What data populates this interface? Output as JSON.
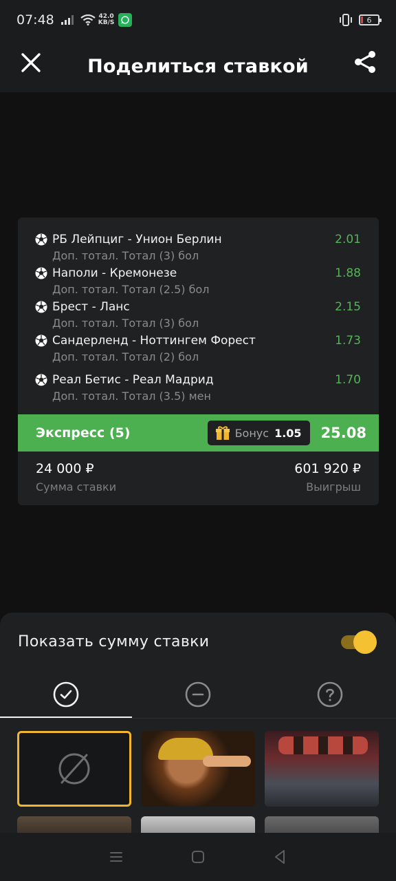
{
  "status": {
    "time": "07:48",
    "speed_value": "42.0",
    "speed_unit": "KB/S",
    "battery": "6"
  },
  "header": {
    "title": "Поделиться ставкой",
    "close_icon": "close-icon",
    "share_icon": "share-icon"
  },
  "bet": {
    "events": [
      {
        "title": "РБ Лейпциг - Унион Берлин",
        "market": "Доп. тотал. Тотал (3) бол",
        "odd": "2.01"
      },
      {
        "title": "Наполи - Кремонезе",
        "market": "Доп. тотал. Тотал (2.5) бол",
        "odd": "1.88"
      },
      {
        "title": "Брест - Ланс",
        "market": "Доп. тотал. Тотал (3) бол",
        "odd": "2.15"
      },
      {
        "title": "Сандерленд - Ноттингем Форест",
        "market": "Доп. тотал. Тотал (2) бол",
        "odd": "1.73"
      },
      {
        "title": "Реал Бетис - Реал Мадрид",
        "market": "Доп. тотал. Тотал (3.5) мен",
        "odd": "1.70"
      }
    ],
    "express_label": "Экспресс (5)",
    "bonus_label": "Бонус",
    "bonus_value": "1.05",
    "total_odd": "25.08",
    "stake_value": "24 000 ₽",
    "stake_caption": "Сумма ставки",
    "win_value": "601 920 ₽",
    "win_caption": "Выигрыш"
  },
  "sheet": {
    "toggle_label": "Показать сумму ставки",
    "toggle_on": true,
    "tabs": [
      {
        "icon": "check-circle-icon",
        "active": true
      },
      {
        "icon": "minus-circle-icon",
        "active": false
      },
      {
        "icon": "question-circle-icon",
        "active": false
      }
    ]
  },
  "colors": {
    "accent_green": "#4caf50",
    "odd_green": "#56b35a",
    "toggle_yellow": "#f4c133",
    "selected_border": "#f2b52e"
  }
}
